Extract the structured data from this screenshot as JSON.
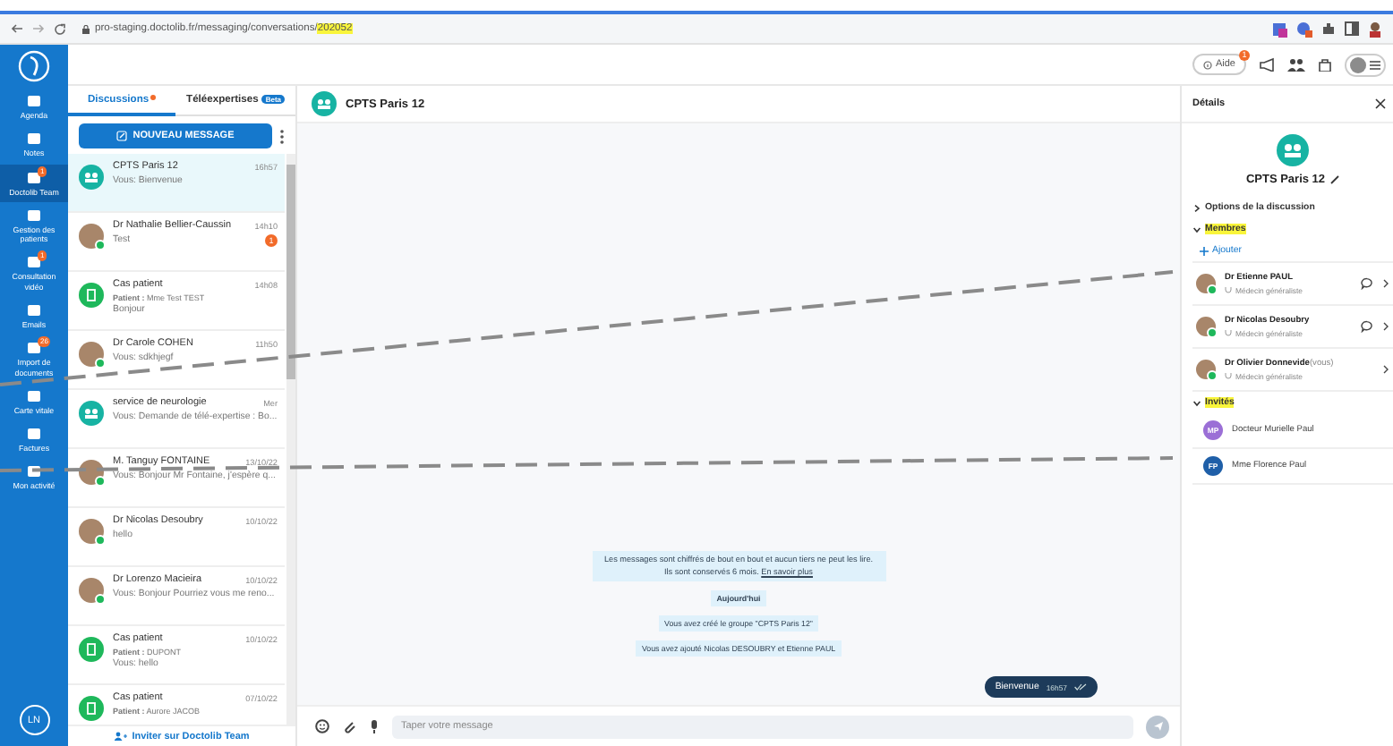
{
  "browser": {
    "url": "pro-staging.doctolib.fr/messaging/conversations/",
    "url_highlight": "202052",
    "highlighted": true
  },
  "header": {
    "help": "Aide",
    "help_badge": "1"
  },
  "nav": {
    "items": [
      {
        "label": "Agenda",
        "selected": false
      },
      {
        "label": "Notes",
        "selected": false
      },
      {
        "label": "Doctolib Team",
        "selected": true,
        "badge": "1"
      },
      {
        "label": "Gestion des patients",
        "selected": false
      },
      {
        "label": "Consultation vidéo",
        "selected": false,
        "badge": "1"
      },
      {
        "label": "Emails",
        "selected": false
      },
      {
        "label": "Import de documents",
        "selected": false,
        "badge": "26"
      },
      {
        "label": "Carte vitale",
        "selected": false
      },
      {
        "label": "Factures",
        "selected": false
      },
      {
        "label": "Mon activité",
        "selected": false
      }
    ],
    "user_initials": "LN"
  },
  "conversations": {
    "tabs": [
      {
        "label": "Discussions",
        "selected": true,
        "dot": true
      },
      {
        "label": "Téléexpertises",
        "selected": false,
        "badge": "Beta"
      }
    ],
    "new_button": "NOUVEAU MESSAGE",
    "items": [
      {
        "kind": "group",
        "name": "CPTS Paris 12",
        "time": "16h57",
        "preview": "Vous: Bienvenue",
        "selected": true,
        "online": false
      },
      {
        "kind": "photo",
        "name": "Dr Nathalie Bellier-Caussin",
        "time": "14h10",
        "preview": "Test",
        "selected": false,
        "online": true,
        "unread": "1"
      },
      {
        "kind": "case",
        "name": "Cas patient",
        "time": "14h08",
        "patient": "**Patient :** Mme Test TEST",
        "preview": "Bonjour",
        "selected": false,
        "online": false
      },
      {
        "kind": "photo",
        "name": "Dr Carole COHEN",
        "time": "11h50",
        "preview": "Vous: sdkhjegf",
        "selected": false,
        "online": true
      },
      {
        "kind": "group",
        "name": "service de neurologie",
        "time": "Mer",
        "preview": "Vous: Demande de télé-expertise : Bo...",
        "selected": false,
        "online": false
      },
      {
        "kind": "photo",
        "name": "M. Tanguy FONTAINE",
        "time": "13/10/22",
        "preview": "Vous: Bonjour Mr Fontaine, j'espère q...",
        "selected": false,
        "online": true
      },
      {
        "kind": "photo",
        "name": "Dr Nicolas Desoubry",
        "time": "10/10/22",
        "preview": "hello",
        "selected": false,
        "online": true
      },
      {
        "kind": "photo",
        "name": "Dr Lorenzo Macieira",
        "time": "10/10/22",
        "preview": "Vous: Bonjour Pourriez vous me reno...",
        "selected": false,
        "online": true
      },
      {
        "kind": "case",
        "name": "Cas patient",
        "time": "10/10/22",
        "patient": "**Patient :** DUPONT",
        "preview": "Vous: hello",
        "selected": false,
        "online": false
      },
      {
        "kind": "case",
        "name": "Cas patient",
        "time": "07/10/22",
        "patient": "**Patient :** Aurore JACOB",
        "selected": false,
        "online": false
      }
    ],
    "invite": "Inviter sur Doctolib Team"
  },
  "chat": {
    "title": "CPTS Paris 12",
    "notice": "Les messages sont chiffrés de bout en bout et aucun tiers ne peut les lire. Ils sont conservés 6 mois.",
    "notice_link": "En savoir plus",
    "date": "Aujourd'hui",
    "events": [
      "Vous avez créé le groupe \"CPTS Paris 12\"",
      "Vous avez ajouté Nicolas DESOUBRY et Etienne PAUL"
    ],
    "message": {
      "text": "Bienvenue",
      "time": "16h57"
    },
    "composer": {
      "placeholder": "Taper votre message",
      "send_disabled": true
    }
  },
  "details": {
    "title": "Détails",
    "group_name": "CPTS Paris 12",
    "sections": [
      {
        "label": "Options de la discussion",
        "expanded": false,
        "highlighted": false
      },
      {
        "label": "Membres",
        "expanded": true,
        "highlighted": true
      },
      {
        "label": "Invités",
        "expanded": true,
        "highlighted": true
      }
    ],
    "add": "Ajouter",
    "members": [
      {
        "name": "Dr Etienne PAUL",
        "role": "Médecin généraliste",
        "chat": true
      },
      {
        "name": "Dr Nicolas Desoubry",
        "role": "Médecin généraliste",
        "chat": true
      },
      {
        "name": "Dr Olivier Donnevide",
        "suffix": "(vous)",
        "role": "Médecin généraliste",
        "chat": false
      }
    ],
    "guests": [
      {
        "initials": "MP",
        "name": "Docteur Murielle Paul",
        "color": "#9b6fd6"
      },
      {
        "initials": "FP",
        "name": "Mme Florence Paul",
        "color": "#1f5fa8"
      }
    ]
  }
}
